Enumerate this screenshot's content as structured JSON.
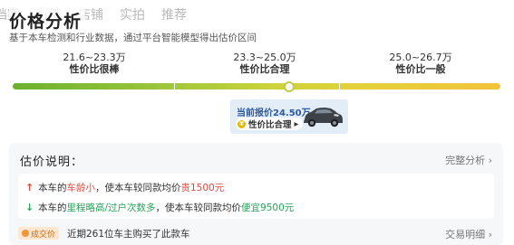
{
  "tabs": [
    "档案",
    "行情",
    "店铺",
    "实拍",
    "推荐"
  ],
  "header": {
    "title": "价格分析",
    "subtitle": "基于本车检测和行业数据，通过平台智能模型得出估价区间"
  },
  "scale": {
    "markers": [
      {
        "range": "21.6~23.3万",
        "prefix": "性价比",
        "rating": "很棒"
      },
      {
        "range": "23.3~25.0万",
        "prefix": "性价比",
        "rating": "合理"
      },
      {
        "range": "25.0~26.7万",
        "prefix": "性价比",
        "rating": "一般"
      }
    ]
  },
  "current": {
    "label": "当前报价24.50万",
    "pill_label": "性价比合理",
    "pill_chevron": "▸"
  },
  "explain": {
    "title": "估价说明：",
    "link": "完整分析",
    "reasons": [
      {
        "direction": "up",
        "prefix": "本车的",
        "key": "车龄小",
        "mid": "，使本车较同款均价",
        "value": "贵1500元"
      },
      {
        "direction": "down",
        "prefix": "本车的",
        "key": "里程略高/过户次数多",
        "mid": "，使本车较同款均价",
        "value": "便宜9500元"
      }
    ]
  },
  "deal": {
    "badge": "成交价",
    "text": "近期261位车主购买了此款车",
    "link": "交易明细"
  },
  "colors": {
    "great": "#5aa52a",
    "fair": "#d8a000",
    "average": "#e08a00",
    "up": "#e24a3b",
    "down": "#2aa35c",
    "price_card_bg": "#e3edf7"
  },
  "icons": {
    "up_arrow": "↑",
    "down_arrow": "↓",
    "chevron": "›",
    "car": "car-icon",
    "coin": "coin-icon"
  }
}
